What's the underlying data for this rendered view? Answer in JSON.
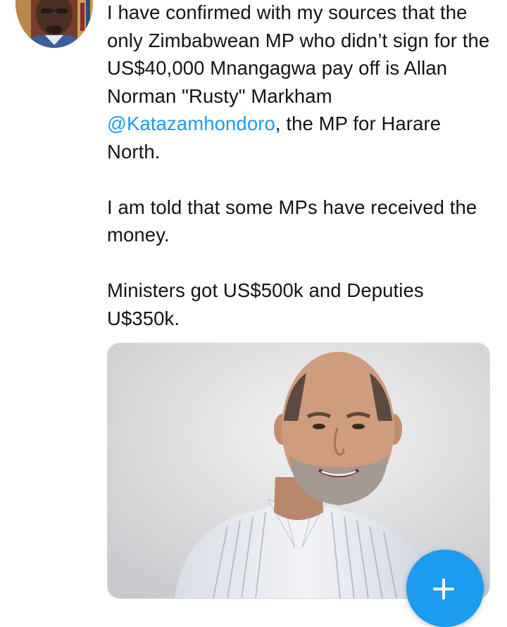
{
  "tweet": {
    "paragraph_1": {
      "before_mention": "I have confirmed with my sources that the only Zimbabwean MP who didn’t sign for the US$40,000 Mnangagwa pay off is Allan Norman \"Rusty\" Markham ",
      "mention": "@Katazamhondoro",
      "after_mention": ", the MP for Harare North."
    },
    "paragraph_2": "I am told that some MPs have received the money.",
    "paragraph_3": "Ministers got US$500k and Deputies U$350k."
  },
  "compose_button": {
    "icon": "plus-icon"
  },
  "colors": {
    "accent": "#1d9bf0",
    "text": "#0f1419",
    "border": "#cfd9de"
  }
}
